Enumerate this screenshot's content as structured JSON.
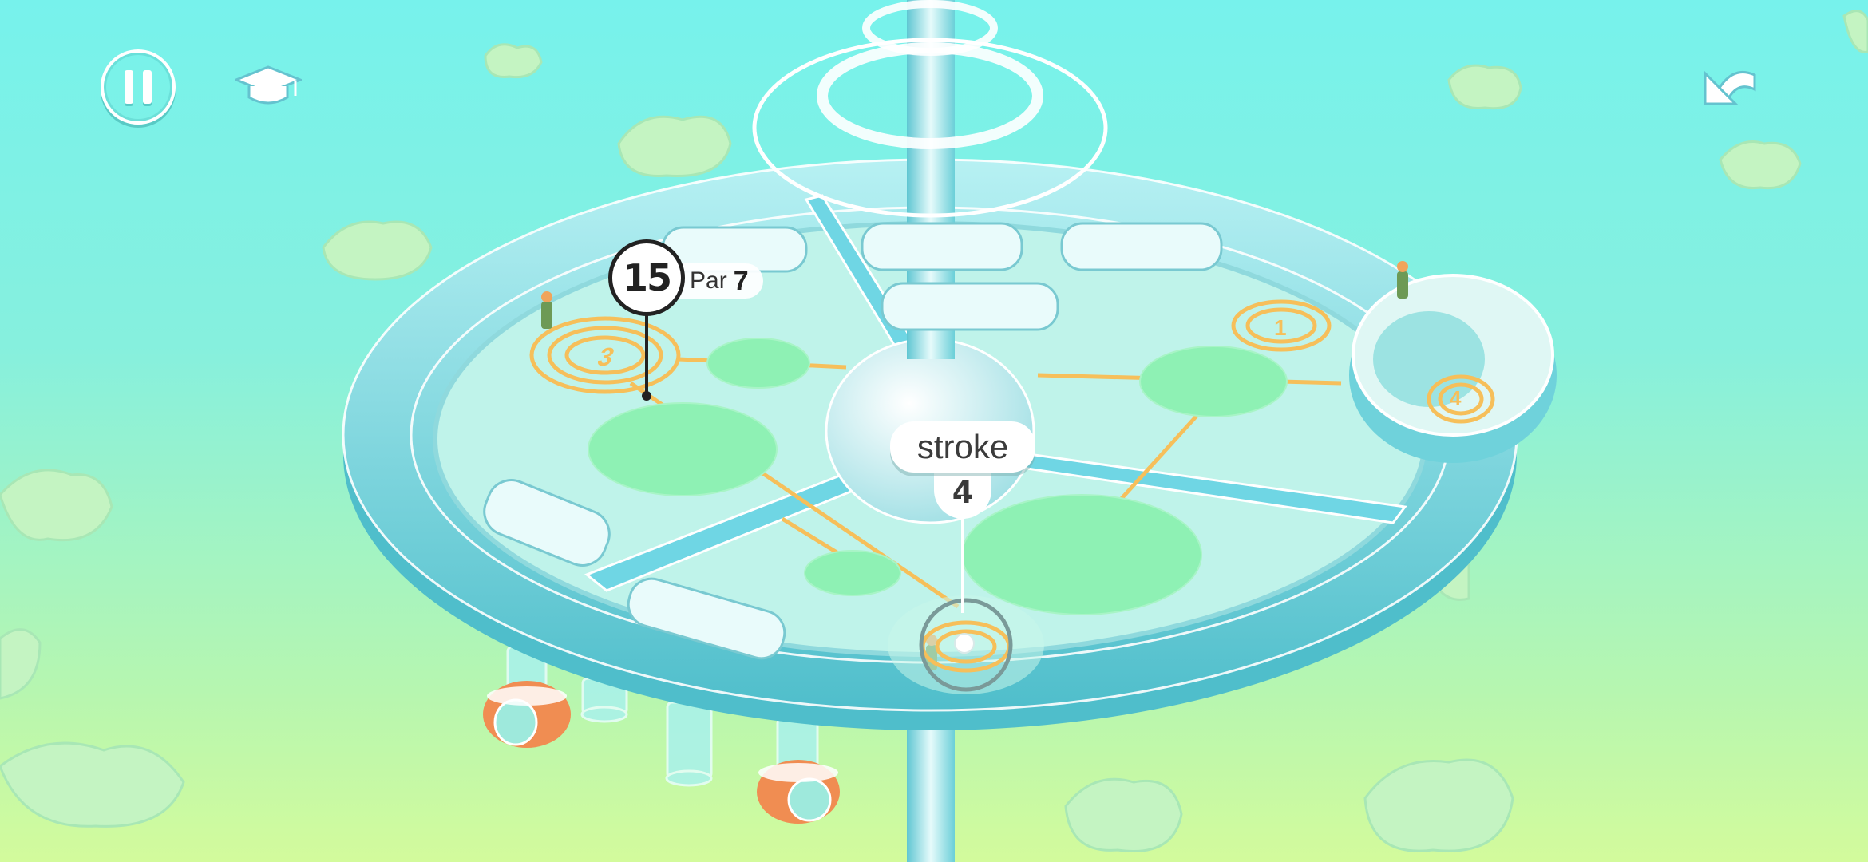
{
  "hud": {
    "pause_icon": "pause-icon",
    "tutorial_icon": "graduation-cap-icon",
    "undo_icon": "undo-arrow-icon"
  },
  "hole": {
    "number": "15",
    "par_label": "Par",
    "par_value": "7"
  },
  "stroke": {
    "label": "stroke",
    "count": "4"
  },
  "helipads": [
    {
      "number": "3"
    },
    {
      "number": "1"
    },
    {
      "number": "4"
    }
  ],
  "colors": {
    "sky_top": "#77f2ec",
    "sky_bottom": "#d3fb9c",
    "platform": "#8fe3e6",
    "rim": "#5fc9d4",
    "green": "#8ef1b4",
    "pad_orange": "#f6bf5a",
    "ui_white": "#ffffff",
    "ui_dark": "#222222"
  }
}
